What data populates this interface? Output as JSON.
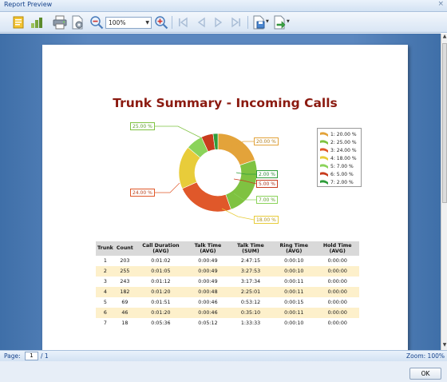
{
  "window": {
    "title": "Report Preview",
    "close_glyph": "×"
  },
  "toolbar": {
    "zoom_value": "100%",
    "icons": [
      "document-map-icon",
      "parameters-icon",
      "print-icon",
      "page-setup-icon",
      "zoom-out-icon",
      "zoom-in-icon",
      "first-page-icon",
      "previous-page-icon",
      "next-page-icon",
      "last-page-icon",
      "save-icon",
      "export-icon"
    ]
  },
  "report": {
    "title": "Trunk Summary - Incoming Calls",
    "callouts": [
      "25.00 %",
      "20.00 %",
      "2.00 %",
      "5.00 %",
      "7.00 %",
      "18.00 %",
      "24.00 %"
    ],
    "legend": [
      {
        "label": "1: 20.00 %",
        "color": "#e3a33a"
      },
      {
        "label": "2: 25.00 %",
        "color": "#7fc241"
      },
      {
        "label": "3: 24.00 %",
        "color": "#e0582a"
      },
      {
        "label": "4: 18.00 %",
        "color": "#e8cc3a"
      },
      {
        "label": "5: 7.00 %",
        "color": "#8bd35a"
      },
      {
        "label": "6: 5.00 %",
        "color": "#c83c1e"
      },
      {
        "label": "7: 2.00 %",
        "color": "#2f9d3a"
      }
    ],
    "table": {
      "headers": [
        "Trunk",
        "Count",
        "Call Duration (AVG)",
        "Talk Time (AVG)",
        "Talk Time (SUM)",
        "Ring Time (AVG)",
        "Hold Time (AVG)"
      ],
      "rows": [
        [
          "1",
          "203",
          "0:01:02",
          "0:00:49",
          "2:47:15",
          "0:00:10",
          "0:00:00"
        ],
        [
          "2",
          "255",
          "0:01:05",
          "0:00:49",
          "3:27:53",
          "0:00:10",
          "0:00:00"
        ],
        [
          "3",
          "243",
          "0:01:12",
          "0:00:49",
          "3:17:34",
          "0:00:11",
          "0:00:00"
        ],
        [
          "4",
          "182",
          "0:01:20",
          "0:00:48",
          "2:25:01",
          "0:00:11",
          "0:00:00"
        ],
        [
          "5",
          "69",
          "0:01:51",
          "0:00:46",
          "0:53:12",
          "0:00:15",
          "0:00:00"
        ],
        [
          "6",
          "46",
          "0:01:20",
          "0:00:46",
          "0:35:10",
          "0:00:11",
          "0:00:00"
        ],
        [
          "7",
          "18",
          "0:05:36",
          "0:05:12",
          "1:33:33",
          "0:00:10",
          "0:00:00"
        ]
      ]
    }
  },
  "chart_data": {
    "type": "pie",
    "variant": "donut",
    "title": "Trunk Summary - Incoming Calls",
    "categories": [
      "1",
      "2",
      "3",
      "4",
      "5",
      "6",
      "7"
    ],
    "values": [
      20.0,
      25.0,
      24.0,
      18.0,
      7.0,
      5.0,
      2.0
    ],
    "unit": "%",
    "colors": [
      "#e3a33a",
      "#7fc241",
      "#e0582a",
      "#e8cc3a",
      "#8bd35a",
      "#c83c1e",
      "#2f9d3a"
    ],
    "legend_position": "right"
  },
  "status": {
    "page_label": "Page:",
    "page_value": "1",
    "page_total": "/ 1",
    "zoom_text": "Zoom: 100%"
  },
  "footer": {
    "ok_label": "OK"
  }
}
